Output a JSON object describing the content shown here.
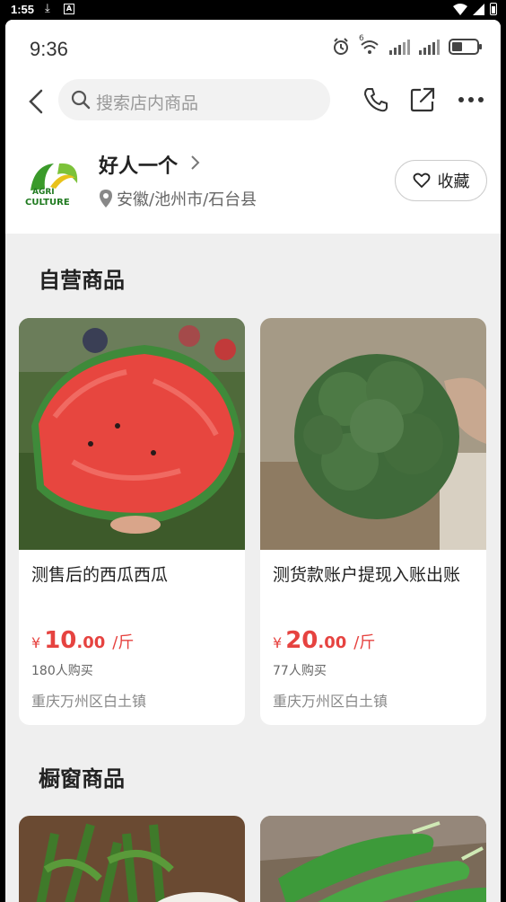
{
  "system_bar": {
    "time": "1:55",
    "download_icon": "⤓",
    "app_icon_letter": "A"
  },
  "status": {
    "time": "9:36",
    "network_label": "6"
  },
  "nav": {
    "search_placeholder": "搜索店内商品"
  },
  "shop": {
    "name": "好人一个",
    "location": "安徽/池州市/石台县",
    "favorite_label": "收藏",
    "logo_text_1": "AGRI",
    "logo_text_2": "CULTURE"
  },
  "sections": {
    "self_operated": "自营商品",
    "showcase": "橱窗商品"
  },
  "products": [
    {
      "title": "测售后的西瓜西瓜",
      "currency": "¥",
      "price_int": "10",
      "price_dec": ".00",
      "unit": "/斤",
      "sold": "180人购买",
      "address": "重庆万州区白土镇",
      "image": "watermelon"
    },
    {
      "title": "测货款账户提现入账出账",
      "currency": "¥",
      "price_int": "20",
      "price_dec": ".00",
      "unit": "/斤",
      "sold": "77人购买",
      "address": "重庆万州区白土镇",
      "image": "broccoli"
    }
  ],
  "showcase_products": [
    {
      "image": "radish"
    },
    {
      "image": "cucumber"
    }
  ],
  "colors": {
    "price": "#e64340",
    "background": "#efefef"
  }
}
